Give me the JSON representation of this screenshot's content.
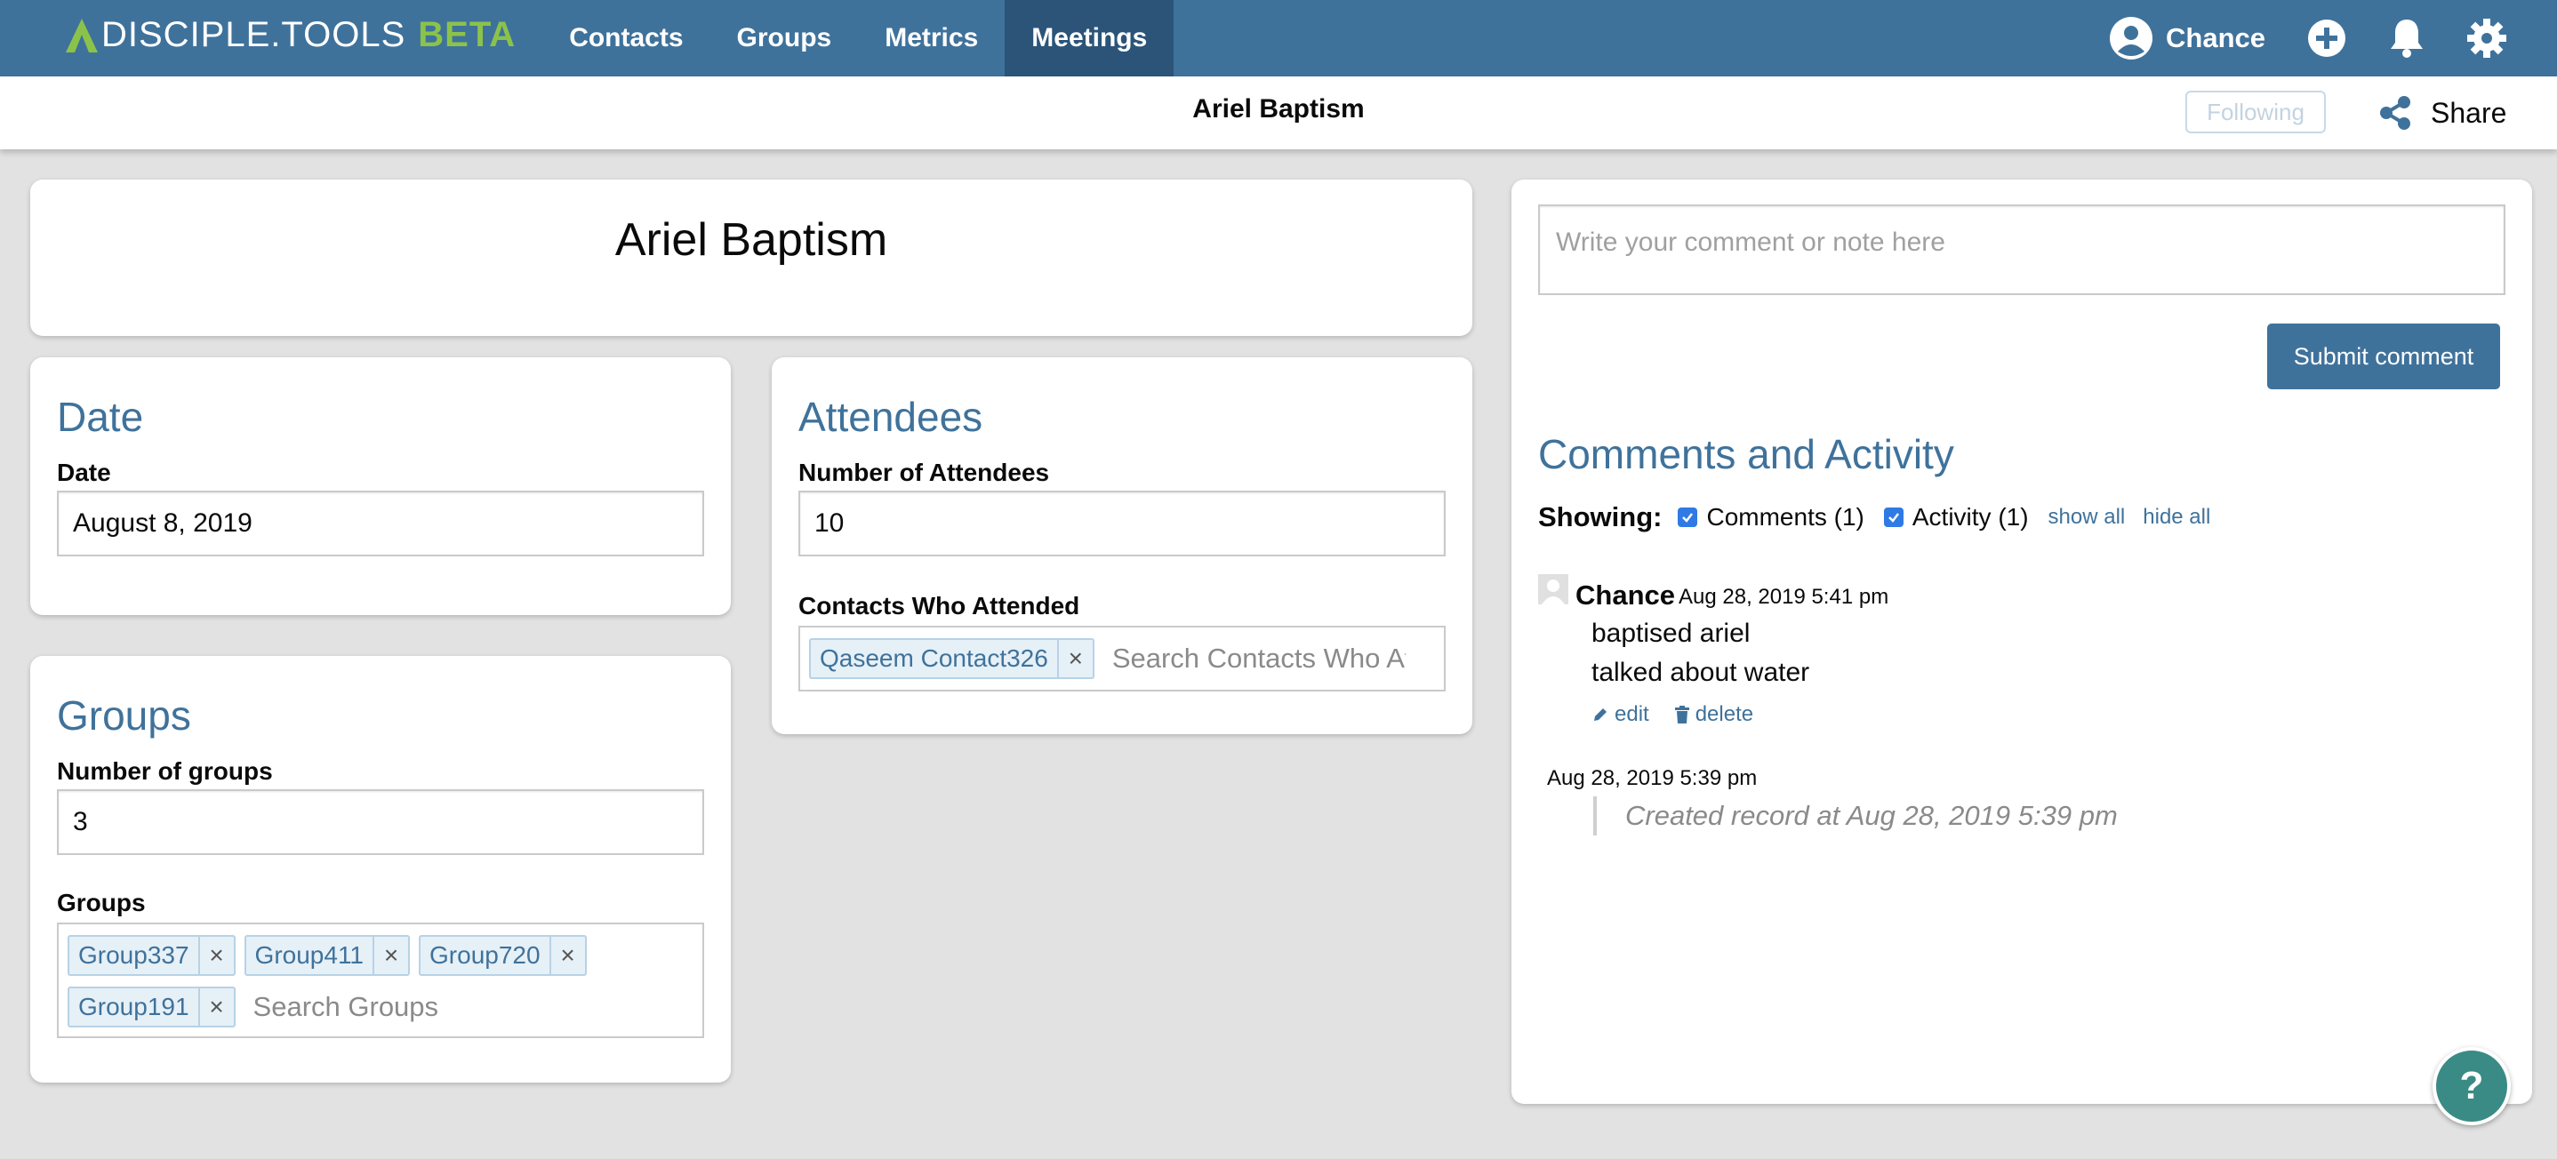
{
  "nav": {
    "logo_text": "DISCIPLE.TOOLS",
    "logo_beta": "BETA",
    "items": [
      {
        "label": "Contacts"
      },
      {
        "label": "Groups"
      },
      {
        "label": "Metrics"
      },
      {
        "label": "Meetings",
        "active": true
      }
    ],
    "user_name": "Chance",
    "icons": [
      "user-avatar-icon",
      "add-icon",
      "bell-icon",
      "gear-icon"
    ]
  },
  "subbar": {
    "title": "Ariel Baptism",
    "following_label": "Following",
    "share_label": "Share"
  },
  "record": {
    "name": "Ariel Baptism"
  },
  "date_section": {
    "title": "Date",
    "label": "Date",
    "value": "August 8, 2019"
  },
  "attendees_section": {
    "title": "Attendees",
    "number_label": "Number of Attendees",
    "number_value": "10",
    "contacts_label": "Contacts Who Attended",
    "contacts": [
      {
        "label": "Qaseem Contact326"
      }
    ],
    "search_placeholder": "Search Contacts Who At"
  },
  "groups_section": {
    "title": "Groups",
    "number_label": "Number of groups",
    "number_value": "3",
    "groups_label": "Groups",
    "groups": [
      {
        "label": "Group337"
      },
      {
        "label": "Group411"
      },
      {
        "label": "Group720"
      },
      {
        "label": "Group191"
      }
    ],
    "search_placeholder": "Search Groups"
  },
  "comments": {
    "input_placeholder": "Write your comment or note here",
    "submit_label": "Submit comment",
    "title": "Comments and Activity",
    "showing_label": "Showing:",
    "filter_comments": "Comments (1)",
    "filter_activity": "Activity (1)",
    "show_all": "show all",
    "hide_all": "hide all",
    "entries": [
      {
        "author": "Chance",
        "date": "Aug 28, 2019 5:41 pm",
        "lines": [
          "baptised ariel",
          "talked about water"
        ],
        "edit_label": "edit",
        "delete_label": "delete"
      }
    ],
    "activity": [
      {
        "date": "Aug 28, 2019 5:39 pm",
        "text": "Created record at Aug 28, 2019 5:39 pm"
      }
    ]
  },
  "help_label": "?",
  "colors": {
    "nav_bg": "#3f729b",
    "nav_active": "#2b5478",
    "brand_green": "#8bc34a",
    "primary": "#3f729b",
    "help_bg": "#3a8b85"
  }
}
